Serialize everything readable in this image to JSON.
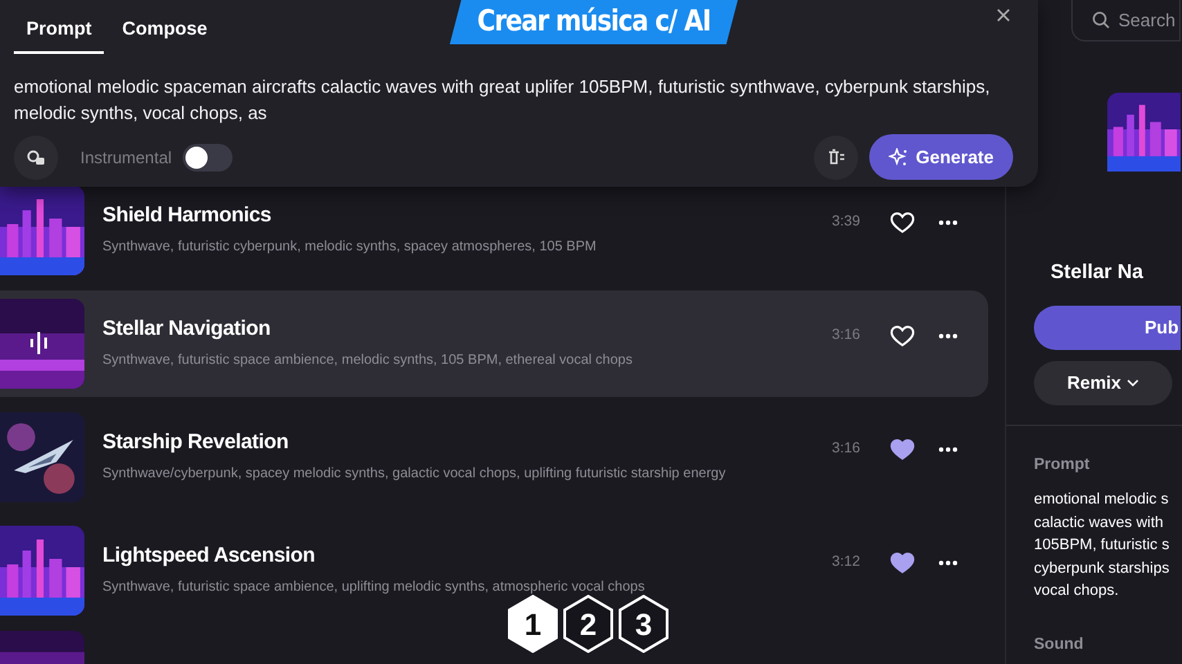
{
  "banner": "Crear música c/ AI",
  "prompt_panel": {
    "tabs": [
      {
        "label": "Prompt",
        "selected": true
      },
      {
        "label": "Compose",
        "selected": false
      }
    ],
    "text": "emotional melodic spaceman aircrafts calactic waves with great uplifer 105BPM, futuristic synthwave, cyberpunk starships, melodic synths, vocal chops, as",
    "instrumental": {
      "label": "Instrumental",
      "on": false
    },
    "generate": "Generate"
  },
  "songs": [
    {
      "title": "Shield Harmonics",
      "tags": "Synthwave, futuristic cyberpunk, melodic synths, spacey atmospheres, 105 BPM",
      "duration": "3:39",
      "liked": false,
      "selected": false,
      "playing": false,
      "kind": "city"
    },
    {
      "title": "Stellar Navigation",
      "tags": "Synthwave, futuristic space ambience, melodic synths, 105 BPM, ethereal vocal chops",
      "duration": "3:16",
      "liked": false,
      "selected": true,
      "playing": true,
      "kind": "glow"
    },
    {
      "title": "Starship Revelation",
      "tags": "Synthwave/cyberpunk, spacey melodic synths, galactic vocal chops, uplifting futuristic starship energy",
      "duration": "3:16",
      "liked": true,
      "selected": false,
      "playing": false,
      "kind": "ship"
    },
    {
      "title": "Lightspeed Ascension",
      "tags": "Synthwave, futuristic space ambience, uplifting melodic synths, atmospheric vocal chops",
      "duration": "3:12",
      "liked": true,
      "selected": false,
      "playing": false,
      "kind": "city"
    },
    {
      "kind": "glow"
    }
  ],
  "steps": [
    "1",
    "2",
    "3"
  ],
  "detail": {
    "search_placeholder": "Search",
    "title": "Stellar Na",
    "publish": "Pub",
    "remix": "Remix",
    "prompt_label": "Prompt",
    "prompt_lines": [
      "emotional melodic s",
      "calactic waves with",
      "105BPM, futuristic s",
      "cyberpunk starships",
      "vocal chops."
    ],
    "sound_label": "Sound"
  }
}
